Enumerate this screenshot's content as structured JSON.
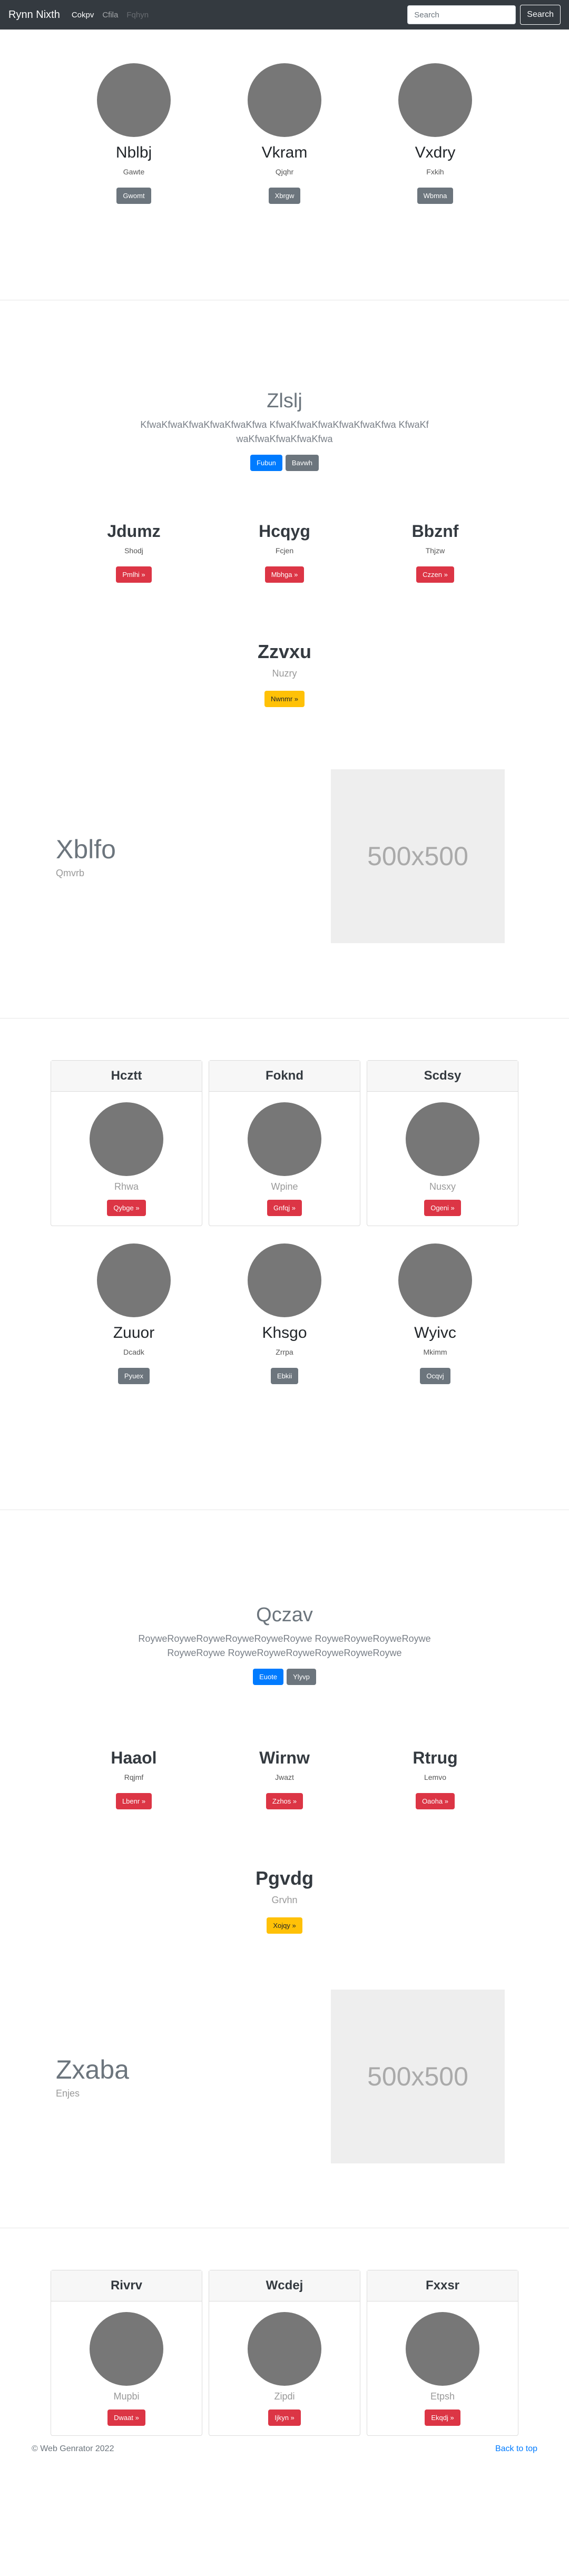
{
  "navbar": {
    "brand": "Rynn Nixth",
    "links": [
      "Cokpv",
      "Cfila",
      "Fqhyn"
    ],
    "search_placeholder": "Search",
    "search_button": "Search"
  },
  "section1": {
    "people": [
      {
        "name": "Nblbj",
        "sub": "Gawte",
        "button": "Gwomt"
      },
      {
        "name": "Vkram",
        "sub": "Qjqhr",
        "button": "Xbrgw"
      },
      {
        "name": "Vxdry",
        "sub": "Fxkih",
        "button": "Wbmna"
      }
    ]
  },
  "hero1": {
    "title": "Zlslj",
    "text": "KfwaKfwaKfwaKfwaKfwaKfwa KfwaKfwaKfwaKfwaKfwaKfwa KfwaKfwaKfwaKfwaKfwaKfwa",
    "primary": "Fubun",
    "secondary": "Bavwh"
  },
  "features1": {
    "items": [
      {
        "title": "Jdumz",
        "sub": "Shodj",
        "button": "Pmlhi »"
      },
      {
        "title": "Hcqyg",
        "sub": "Fcjen",
        "button": "Mbhga »"
      },
      {
        "title": "Bbznf",
        "sub": "Thjzw",
        "button": "Czzen »"
      }
    ],
    "center": {
      "title": "Zzvxu",
      "sub": "Nuzry",
      "button": "Nwnmr »"
    }
  },
  "featurette1": {
    "title": "Xblfo",
    "sub": "Qmvrb",
    "placeholder": "500x500"
  },
  "cards1": {
    "items": [
      {
        "header": "Hcztt",
        "sub": "Rhwa",
        "button": "Qybge »"
      },
      {
        "header": "Foknd",
        "sub": "Wpine",
        "button": "Gnfqj »"
      },
      {
        "header": "Scdsy",
        "sub": "Nusxy",
        "button": "Ogeni »"
      }
    ]
  },
  "section2": {
    "people": [
      {
        "name": "Zuuor",
        "sub": "Dcadk",
        "button": "Pyuex"
      },
      {
        "name": "Khsgo",
        "sub": "Zrrpa",
        "button": "Ebkii"
      },
      {
        "name": "Wyivc",
        "sub": "Mkimm",
        "button": "Ocqvj"
      }
    ]
  },
  "hero2": {
    "title": "Qczav",
    "text": "RoyweRoyweRoyweRoyweRoyweRoywe RoyweRoyweRoyweRoyweRoyweRoywe RoyweRoyweRoyweRoyweRoyweRoywe",
    "primary": "Euote",
    "secondary": "Ylyvp"
  },
  "features2": {
    "items": [
      {
        "title": "Haaol",
        "sub": "Rqjmf",
        "button": "Lbenr »"
      },
      {
        "title": "Wirnw",
        "sub": "Jwazt",
        "button": "Zzhos »"
      },
      {
        "title": "Rtrug",
        "sub": "Lemvo",
        "button": "Oaoha »"
      }
    ],
    "center": {
      "title": "Pgvdg",
      "sub": "Grvhn",
      "button": "Xojqy »"
    }
  },
  "featurette2": {
    "title": "Zxaba",
    "sub": "Enjes",
    "placeholder": "500x500"
  },
  "cards2": {
    "items": [
      {
        "header": "Rivrv",
        "sub": "Mupbi",
        "button": "Dwaat »"
      },
      {
        "header": "Wcdej",
        "sub": "Zipdi",
        "button": "Ijkyn »"
      },
      {
        "header": "Fxxsr",
        "sub": "Etpsh",
        "button": "Ekqdj »"
      }
    ]
  },
  "footer": {
    "copyright": "© Web Genrator 2022",
    "back_to_top": "Back to top"
  }
}
